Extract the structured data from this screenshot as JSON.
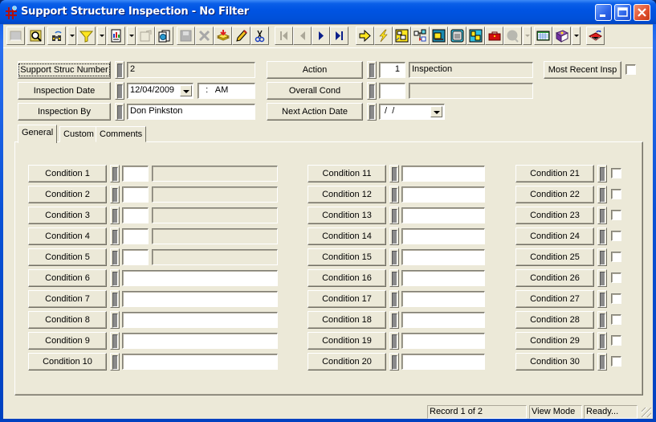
{
  "window": {
    "title": "Support Structure Inspection - No Filter",
    "controls": {
      "minimize": "minimize",
      "maximize": "maximize",
      "close": "close"
    }
  },
  "toolbar": {
    "buttons": [
      {
        "name": "select-all-button",
        "icon": "grid-icon",
        "enabled": false
      },
      {
        "name": "find-button",
        "icon": "magnify-book-icon",
        "enabled": true
      },
      {
        "name": "search-binoculars-button",
        "icon": "binoculars-icon",
        "enabled": true,
        "dropdown": true
      },
      {
        "name": "filter-button",
        "icon": "funnel-icon",
        "enabled": true,
        "dropdown": true
      },
      {
        "name": "report-button",
        "icon": "report-icon",
        "enabled": true,
        "dropdown": true
      },
      {
        "name": "export-button",
        "icon": "export-doc-icon",
        "enabled": false
      },
      {
        "name": "copy-record-button",
        "icon": "copy-globe-icon",
        "enabled": true
      },
      {
        "name": "save-button",
        "icon": "floppy-icon",
        "enabled": false
      },
      {
        "name": "delete-button",
        "icon": "x-icon",
        "enabled": false
      },
      {
        "name": "new-record-button",
        "icon": "stack-add-icon",
        "enabled": true
      },
      {
        "name": "edit-button",
        "icon": "pencil-icon",
        "enabled": true
      },
      {
        "name": "cut-button",
        "icon": "scissors-icon",
        "enabled": true
      },
      {
        "name": "first-record-button",
        "icon": "first-icon",
        "enabled": false
      },
      {
        "name": "previous-record-button",
        "icon": "previous-icon",
        "enabled": false
      },
      {
        "name": "next-record-button",
        "icon": "next-icon",
        "enabled": true
      },
      {
        "name": "last-record-button",
        "icon": "last-icon",
        "enabled": true
      },
      {
        "name": "goto-button",
        "icon": "yellow-arrow-icon",
        "enabled": true
      },
      {
        "name": "quick-action-button",
        "icon": "lightning-icon",
        "enabled": true
      },
      {
        "name": "structure-button",
        "icon": "structure-icon",
        "enabled": true
      },
      {
        "name": "hierarchy-button",
        "icon": "hierarchy-icon",
        "enabled": true
      },
      {
        "name": "equipment-button",
        "icon": "bulldozer-icon",
        "enabled": true
      },
      {
        "name": "calculator-button",
        "icon": "calculator-icon",
        "enabled": true
      },
      {
        "name": "map-button",
        "icon": "map-icon",
        "enabled": true
      },
      {
        "name": "toolbox-button",
        "icon": "toolbox-icon",
        "enabled": true
      },
      {
        "name": "help-bubble-button",
        "icon": "bubble-icon",
        "enabled": false,
        "dropdown": true
      },
      {
        "name": "spreadsheet-button",
        "icon": "spreadsheet-icon",
        "enabled": true
      },
      {
        "name": "help-book-button",
        "icon": "book-icon",
        "enabled": true,
        "dropdown": true
      },
      {
        "name": "exit-button",
        "icon": "exit-icon",
        "enabled": true
      }
    ]
  },
  "header": {
    "support_struc_number": {
      "label": "Support Struc Number",
      "value": "2"
    },
    "inspection_date": {
      "label": "Inspection Date",
      "date": "12/04/2009",
      "time": "  :   AM"
    },
    "inspection_by": {
      "label": "Inspection By",
      "value": "Don Pinkston"
    },
    "action": {
      "label": "Action",
      "code": "1",
      "description": "Inspection"
    },
    "overall_cond": {
      "label": "Overall Cond",
      "code": "",
      "description": ""
    },
    "next_action_date": {
      "label": "Next Action Date",
      "value": " /  /"
    },
    "most_recent_insp": {
      "label": "Most Recent Insp",
      "checked": false
    }
  },
  "tabs": [
    {
      "label": "General",
      "active": true
    },
    {
      "label": "Custom",
      "active": false
    },
    {
      "label": "Comments",
      "active": false
    }
  ],
  "general": {
    "conditions_col1": [
      {
        "label": "Condition 1",
        "code": "",
        "description": ""
      },
      {
        "label": "Condition 2",
        "code": "",
        "description": ""
      },
      {
        "label": "Condition 3",
        "code": "",
        "description": ""
      },
      {
        "label": "Condition 4",
        "code": "",
        "description": ""
      },
      {
        "label": "Condition 5",
        "code": "",
        "description": ""
      },
      {
        "label": "Condition 6",
        "value": ""
      },
      {
        "label": "Condition 7",
        "value": ""
      },
      {
        "label": "Condition 8",
        "value": ""
      },
      {
        "label": "Condition 9",
        "value": ""
      },
      {
        "label": "Condition 10",
        "value": ""
      }
    ],
    "conditions_col2": [
      {
        "label": "Condition 11",
        "value": ""
      },
      {
        "label": "Condition 12",
        "value": ""
      },
      {
        "label": "Condition 13",
        "value": ""
      },
      {
        "label": "Condition 14",
        "value": ""
      },
      {
        "label": "Condition 15",
        "value": ""
      },
      {
        "label": "Condition 16",
        "value": ""
      },
      {
        "label": "Condition 17",
        "value": ""
      },
      {
        "label": "Condition 18",
        "value": ""
      },
      {
        "label": "Condition 19",
        "value": ""
      },
      {
        "label": "Condition 20",
        "value": ""
      }
    ],
    "conditions_col3": [
      {
        "label": "Condition 21",
        "checked": false
      },
      {
        "label": "Condition 22",
        "checked": false
      },
      {
        "label": "Condition 23",
        "checked": false
      },
      {
        "label": "Condition 24",
        "checked": false
      },
      {
        "label": "Condition 25",
        "checked": false
      },
      {
        "label": "Condition 26",
        "checked": false
      },
      {
        "label": "Condition 27",
        "checked": false
      },
      {
        "label": "Condition 28",
        "checked": false
      },
      {
        "label": "Condition 29",
        "checked": false
      },
      {
        "label": "Condition 30",
        "checked": false
      }
    ]
  },
  "statusbar": {
    "record": "Record 1 of 2",
    "mode": "View Mode",
    "status": "Ready..."
  }
}
